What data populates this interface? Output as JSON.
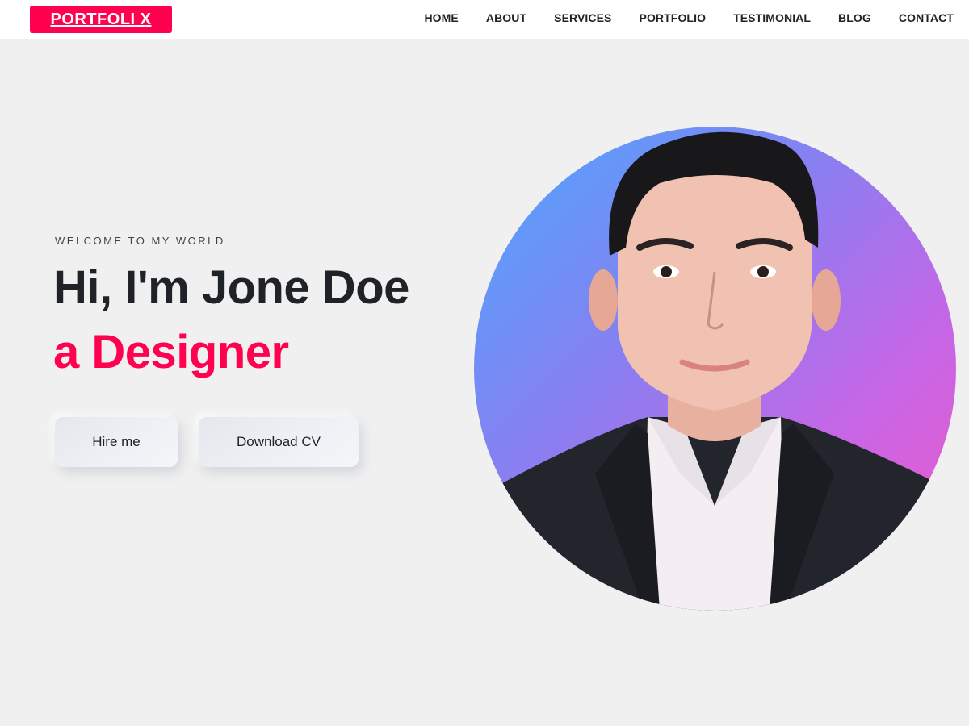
{
  "header": {
    "logo": "PORTFOLI X",
    "nav": [
      "HOME",
      "ABOUT",
      "SERVICES",
      "PORTFOLIO",
      "TESTIMONIAL",
      "BLOG",
      "CONTACT"
    ]
  },
  "hero": {
    "welcome": "WELCOME TO MY WORLD",
    "title": "Hi, I'm Jone Doe",
    "subtitle": "a Designer",
    "buttons": {
      "hire": "Hire me",
      "cv": "Download CV"
    }
  },
  "colors": {
    "accent": "#ff014f",
    "text": "#1f2226",
    "background": "#f0f0f0"
  },
  "portrait": {
    "icon": "profile-photo"
  }
}
